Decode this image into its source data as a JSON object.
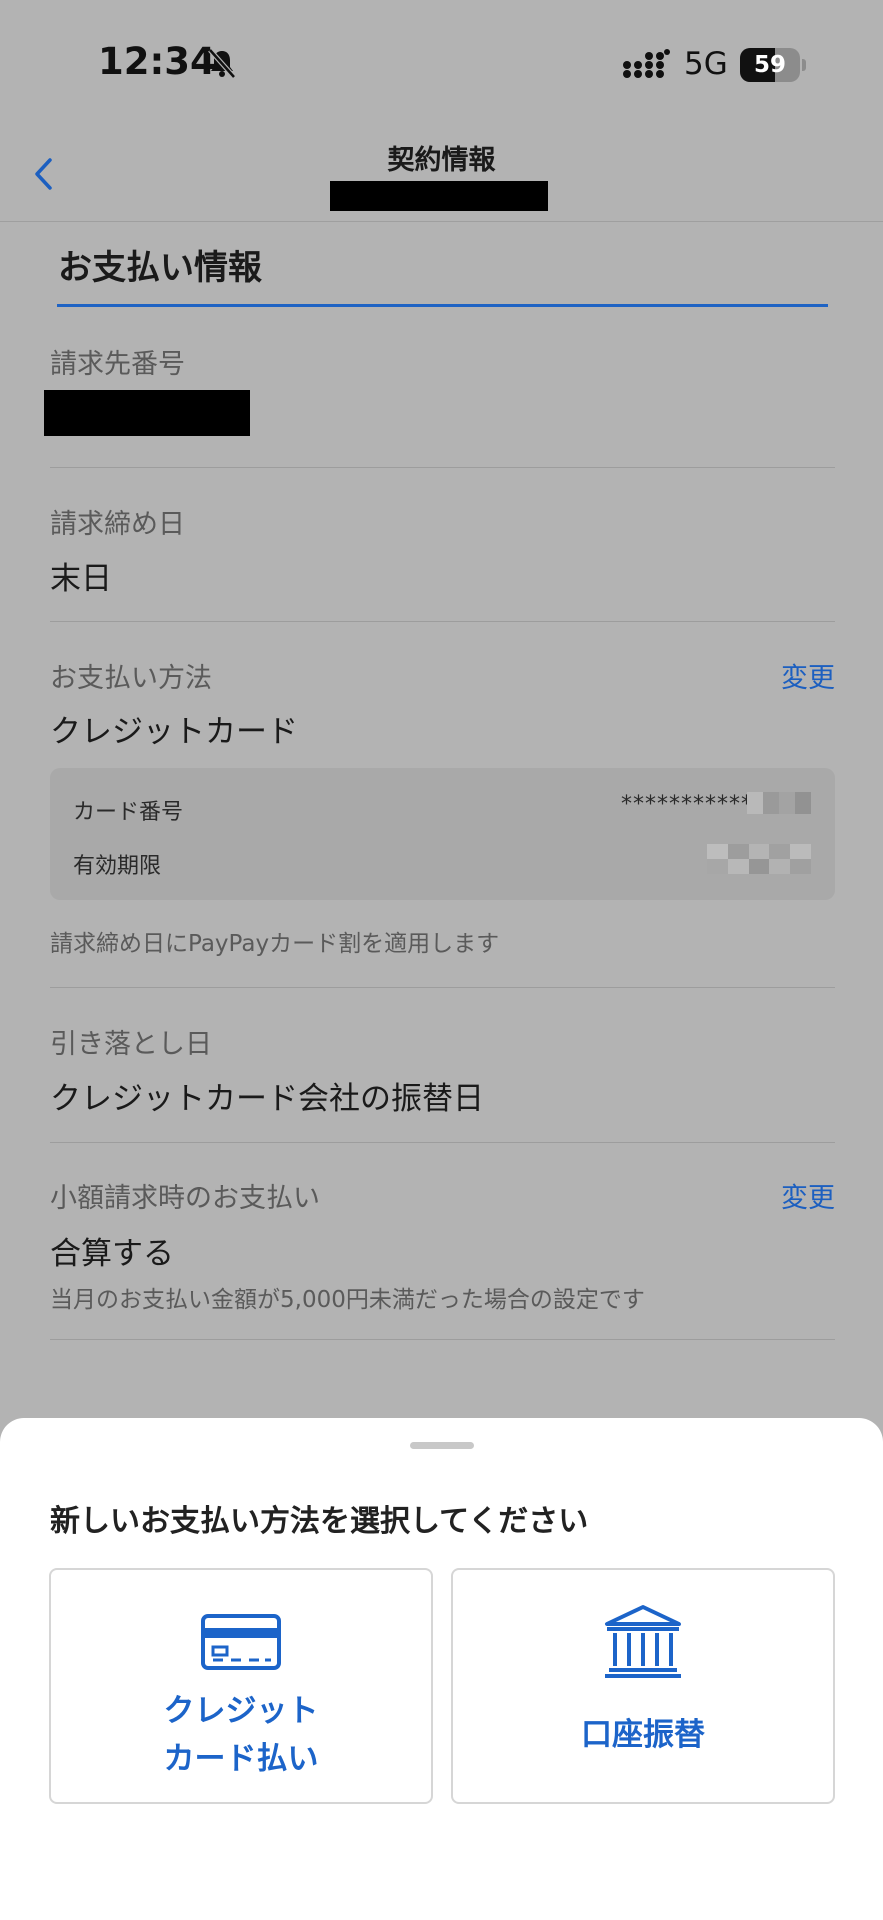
{
  "status_bar": {
    "time": "12:34",
    "network": "5G",
    "battery": "59",
    "icons": [
      "bell-slash-icon",
      "signal-icon",
      "battery-icon"
    ]
  },
  "nav": {
    "title": "契約情報",
    "back_icon": "chevron-left-icon"
  },
  "section": {
    "title": "お支払い情報"
  },
  "billing_number": {
    "label": "請求先番号"
  },
  "closing_date": {
    "label": "請求締め日",
    "value": "末日"
  },
  "payment_method": {
    "label": "お支払い方法",
    "change": "変更",
    "value": "クレジットカード",
    "card_number_label": "カード番号",
    "card_number_value": "************",
    "expiry_label": "有効期限",
    "note": "請求締め日にPayPayカード割を適用します"
  },
  "withdrawal_date": {
    "label": "引き落とし日",
    "value": "クレジットカード会社の振替日"
  },
  "small_billing": {
    "label": "小額請求時のお支払い",
    "change": "変更",
    "value": "合算する",
    "note": "当月のお支払い金額が5,000円未満だった場合の設定です"
  },
  "sheet": {
    "title": "新しいお支払い方法を選択してください",
    "options": [
      {
        "icon": "credit-card-icon",
        "label_line1": "クレジット",
        "label_line2": "カード払い"
      },
      {
        "icon": "bank-icon",
        "label": "口座振替"
      }
    ]
  },
  "colors": {
    "accent": "#1c64c9",
    "overlay_background": "#b3b3b3",
    "sheet_background": "#ffffff"
  }
}
